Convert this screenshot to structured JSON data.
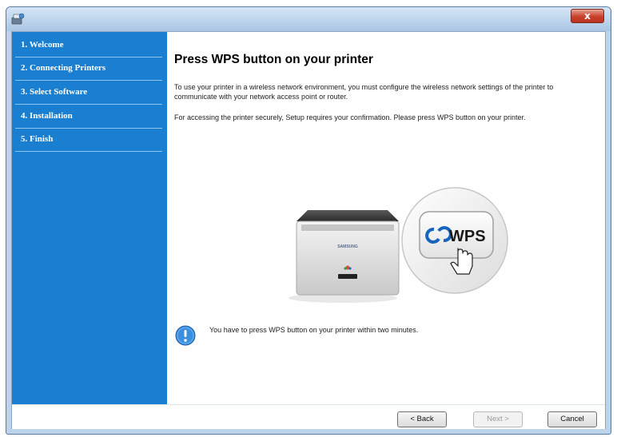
{
  "window": {
    "close_label": "x"
  },
  "sidebar": {
    "steps": [
      {
        "label": "1. Welcome"
      },
      {
        "label": "2. Connecting Printers"
      },
      {
        "label": "3. Select Software"
      },
      {
        "label": "4. Installation"
      },
      {
        "label": "5. Finish"
      }
    ]
  },
  "content": {
    "heading": "Press WPS button on your printer",
    "paragraph1": "To use your printer in a wireless network environment, you must configure the wireless network settings of the printer to communicate with your network access point or router.",
    "paragraph2": "For accessing the printer securely, Setup requires your confirmation. Please press WPS button on your printer.",
    "illustration": {
      "printer_brand": "SAMSUNG",
      "button_label": "WPS"
    },
    "notice": "You have to press WPS button on your printer within two minutes."
  },
  "footer": {
    "back_label": "< Back",
    "next_label": "Next >",
    "cancel_label": "Cancel"
  }
}
